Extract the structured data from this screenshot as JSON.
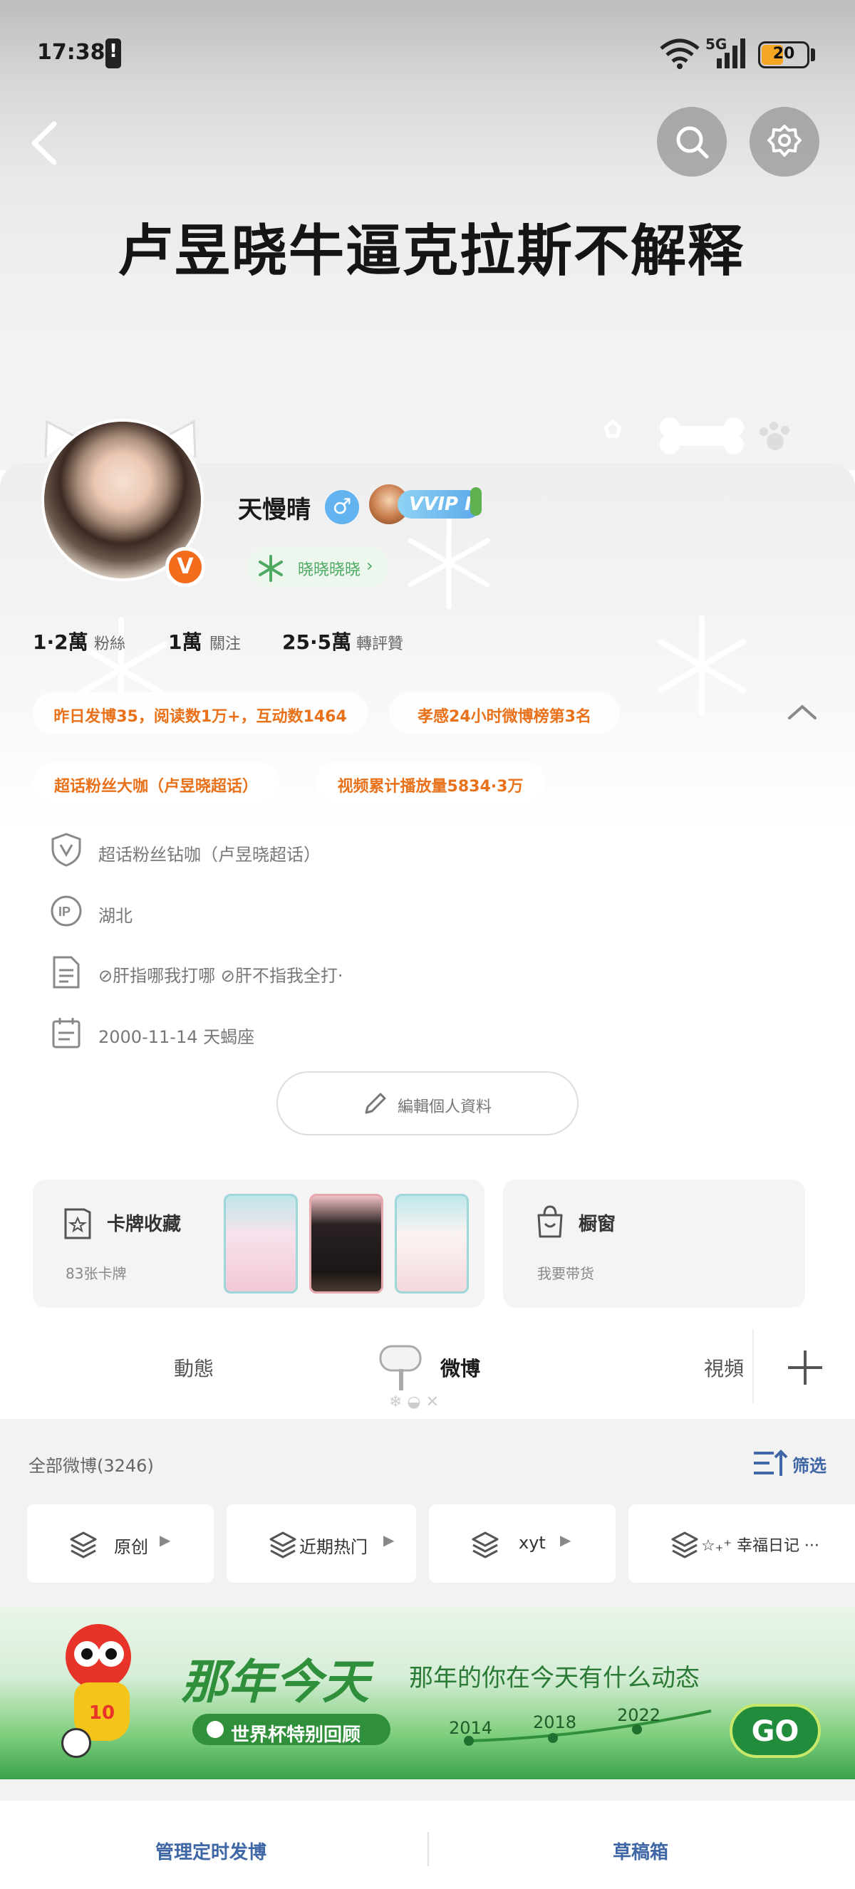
{
  "status_bar": {
    "time": "17:38",
    "network": "5G",
    "battery": "20"
  },
  "header": {
    "title": "卢昱晓牛逼克拉斯不解释"
  },
  "profile": {
    "name": "天慢晴",
    "gender_icon": "♂",
    "vip_label": "VVIP I",
    "verified_badge": "V",
    "supertopic_label": "晓晓晓晓",
    "stats": [
      {
        "value": "1·2萬",
        "label": "粉絲"
      },
      {
        "value": "1萬",
        "label": "關注"
      },
      {
        "value": "25·5萬",
        "label": "轉評贊"
      }
    ],
    "tags": [
      "昨日发博35，阅读数1万+，互动数1464",
      "孝感24小时微博榜第3名",
      "超话粉丝大咖（卢昱晓超话）",
      "视频累计播放量5834·3万"
    ],
    "info": [
      {
        "icon": "shield-v-icon",
        "text": "超话粉丝钻咖（卢昱晓超话）"
      },
      {
        "icon": "ip-icon",
        "text": "湖北"
      },
      {
        "icon": "document-icon",
        "text": "⊘肝指哪我打哪  ⊘肝不指我全打·"
      },
      {
        "icon": "calendar-icon",
        "text": "2000-11-14 天蝎座"
      }
    ],
    "edit_label": "編輯個人資料"
  },
  "cards": {
    "collection": {
      "title": "卡牌收藏",
      "subtitle": "83张卡牌"
    },
    "showcase": {
      "title": "橱窗",
      "subtitle": "我要带货"
    }
  },
  "tabs": [
    {
      "label": "動態"
    },
    {
      "label": "微博",
      "active": true
    },
    {
      "label": "視頻"
    }
  ],
  "feed": {
    "count_label": "全部微博(3246)",
    "filter_label": "筛选",
    "groups": [
      "原创",
      "近期热门",
      "xyt",
      "☆₊⁺ 幸福日记 ···"
    ]
  },
  "banner": {
    "title": "那年今天",
    "subtitle": "那年的你在今天有什么动态",
    "pill": "世界杯特别回顾",
    "years": [
      "2014",
      "2018",
      "2022"
    ],
    "go": "GO",
    "mascot_number": "10"
  },
  "bottom": {
    "left": "管理定时发博",
    "right": "草稿箱"
  },
  "colors": {
    "accent_orange": "#e8711a",
    "link_blue": "#3f66a5",
    "green": "#2f8f3a"
  }
}
